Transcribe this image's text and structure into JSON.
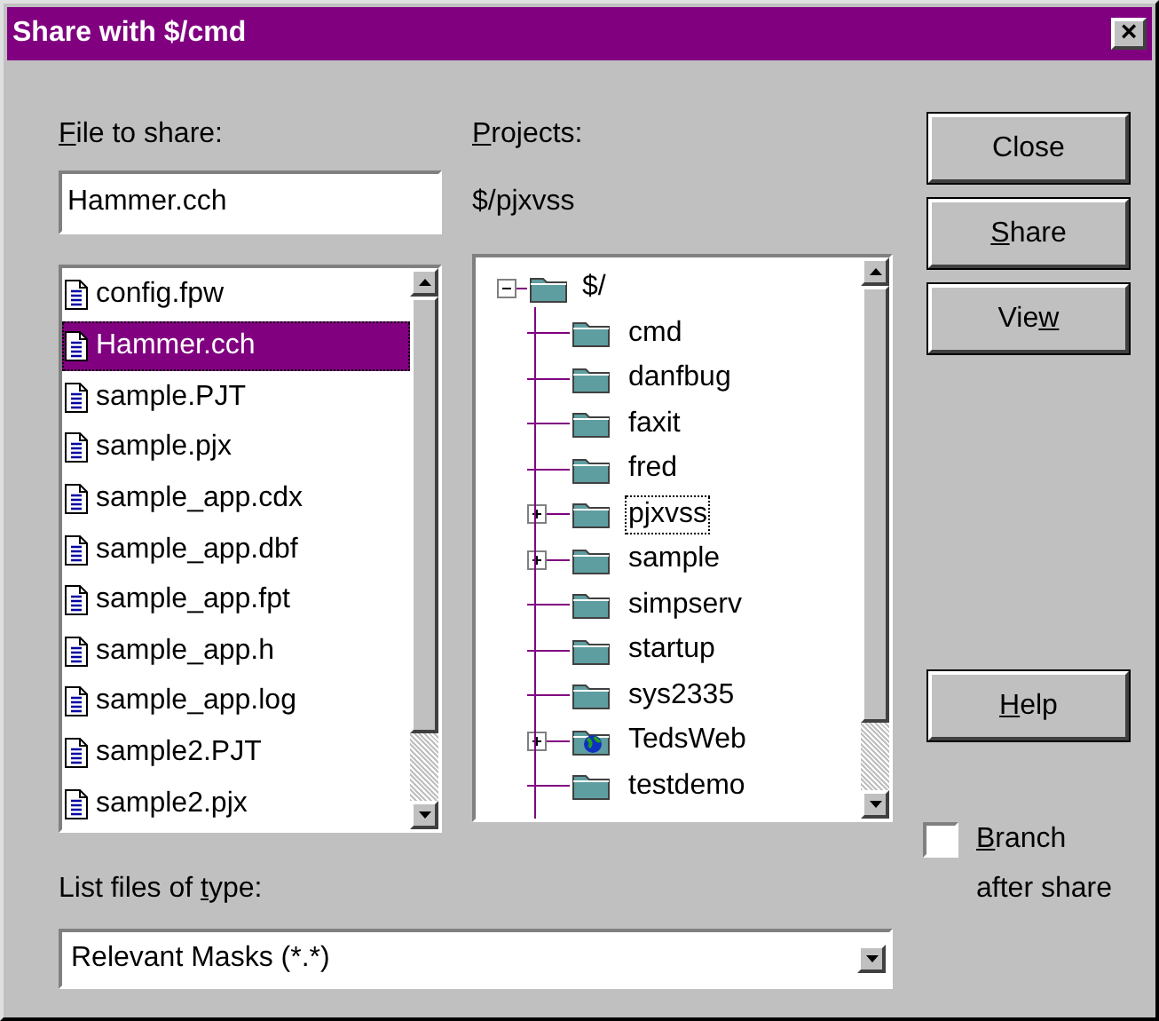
{
  "window": {
    "title": "Share with $/cmd",
    "close": "×"
  },
  "file_label": {
    "parts": [
      {
        "text": "F",
        "underlined": true
      },
      {
        "text": "ile to share:",
        "underlined": false
      }
    ]
  },
  "file_field": {
    "value": "Hammer.cch"
  },
  "files": [
    {
      "name": "config.fpw",
      "selected": false
    },
    {
      "name": "Hammer.cch",
      "selected": true
    },
    {
      "name": "sample.PJT",
      "selected": false
    },
    {
      "name": "sample.pjx",
      "selected": false
    },
    {
      "name": "sample_app.cdx",
      "selected": false
    },
    {
      "name": "sample_app.dbf",
      "selected": false
    },
    {
      "name": "sample_app.fpt",
      "selected": false
    },
    {
      "name": "sample_app.h",
      "selected": false
    },
    {
      "name": "sample_app.log",
      "selected": false
    },
    {
      "name": "sample2.PJT",
      "selected": false
    },
    {
      "name": "sample2.pjx",
      "selected": false
    }
  ],
  "projects_label": {
    "parts": [
      {
        "text": "P",
        "underlined": true
      },
      {
        "text": "rojects:",
        "underlined": false
      }
    ]
  },
  "current_project": "$/pjxvss",
  "tree": [
    {
      "name": "$/",
      "kind": "folder",
      "expanded": true,
      "selected": false,
      "children": [
        {
          "name": "cmd",
          "kind": "folder",
          "has_children": false,
          "selected": false
        },
        {
          "name": "danfbug",
          "kind": "folder",
          "has_children": false,
          "selected": false
        },
        {
          "name": "faxit",
          "kind": "folder",
          "has_children": false,
          "selected": false
        },
        {
          "name": "fred",
          "kind": "folder",
          "has_children": false,
          "selected": false
        },
        {
          "name": "pjxvss",
          "kind": "folder",
          "has_children": true,
          "selected": true
        },
        {
          "name": "sample",
          "kind": "folder",
          "has_children": true,
          "selected": false
        },
        {
          "name": "simpserv",
          "kind": "folder",
          "has_children": false,
          "selected": false
        },
        {
          "name": "startup",
          "kind": "folder",
          "has_children": false,
          "selected": false
        },
        {
          "name": "sys2335",
          "kind": "folder",
          "has_children": false,
          "selected": false
        },
        {
          "name": "TedsWeb",
          "kind": "web",
          "has_children": true,
          "selected": false
        },
        {
          "name": "testdemo",
          "kind": "folder",
          "has_children": false,
          "selected": false
        }
      ]
    }
  ],
  "buttons": [
    {
      "parts": [
        {
          "text": "Close",
          "underlined": false
        }
      ]
    },
    {
      "parts": [
        {
          "text": "S",
          "underlined": true
        },
        {
          "text": "hare",
          "underlined": false
        }
      ]
    },
    {
      "parts": [
        {
          "text": "Vie",
          "underlined": false
        },
        {
          "text": "w",
          "underlined": true
        }
      ]
    }
  ],
  "help_button": {
    "parts": [
      {
        "text": "H",
        "underlined": true
      },
      {
        "text": "elp",
        "underlined": false
      }
    ]
  },
  "type_label": {
    "parts": [
      {
        "text": "List files of ",
        "underlined": false
      },
      {
        "text": "t",
        "underlined": true
      },
      {
        "text": "ype:",
        "underlined": false
      }
    ]
  },
  "type_select": {
    "value": "Relevant Masks (*.*)"
  },
  "branch": {
    "parts": [
      {
        "text": "B",
        "underlined": true
      },
      {
        "text": "ranch",
        "underlined": false
      }
    ],
    "label_2": "after share",
    "checked": false
  }
}
